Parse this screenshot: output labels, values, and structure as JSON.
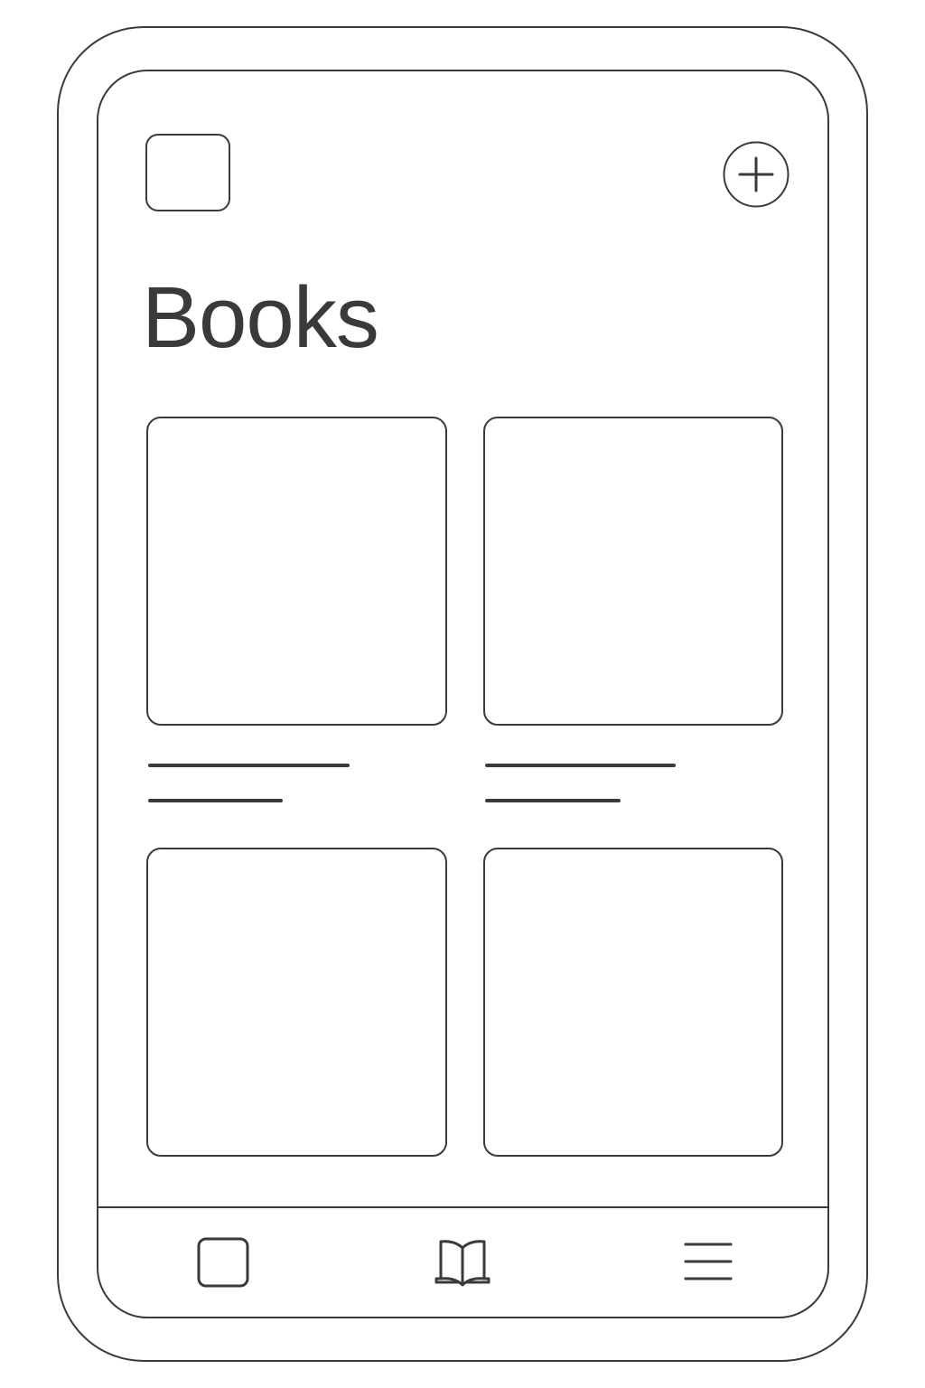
{
  "header": {
    "title": "Books",
    "left_icon": "square-icon",
    "add_icon": "plus-circle-icon"
  },
  "books": [
    {
      "cover_icon": "book-cover-placeholder",
      "title_placeholder": "text-line",
      "subtitle_placeholder": "text-line"
    },
    {
      "cover_icon": "book-cover-placeholder",
      "title_placeholder": "text-line",
      "subtitle_placeholder": "text-line"
    },
    {
      "cover_icon": "book-cover-placeholder"
    },
    {
      "cover_icon": "book-cover-placeholder"
    }
  ],
  "tab_bar": {
    "items": [
      {
        "icon": "square-icon"
      },
      {
        "icon": "open-book-icon"
      },
      {
        "icon": "menu-icon"
      }
    ]
  },
  "colors": {
    "stroke": "#3a3a3a",
    "background": "#ffffff"
  }
}
